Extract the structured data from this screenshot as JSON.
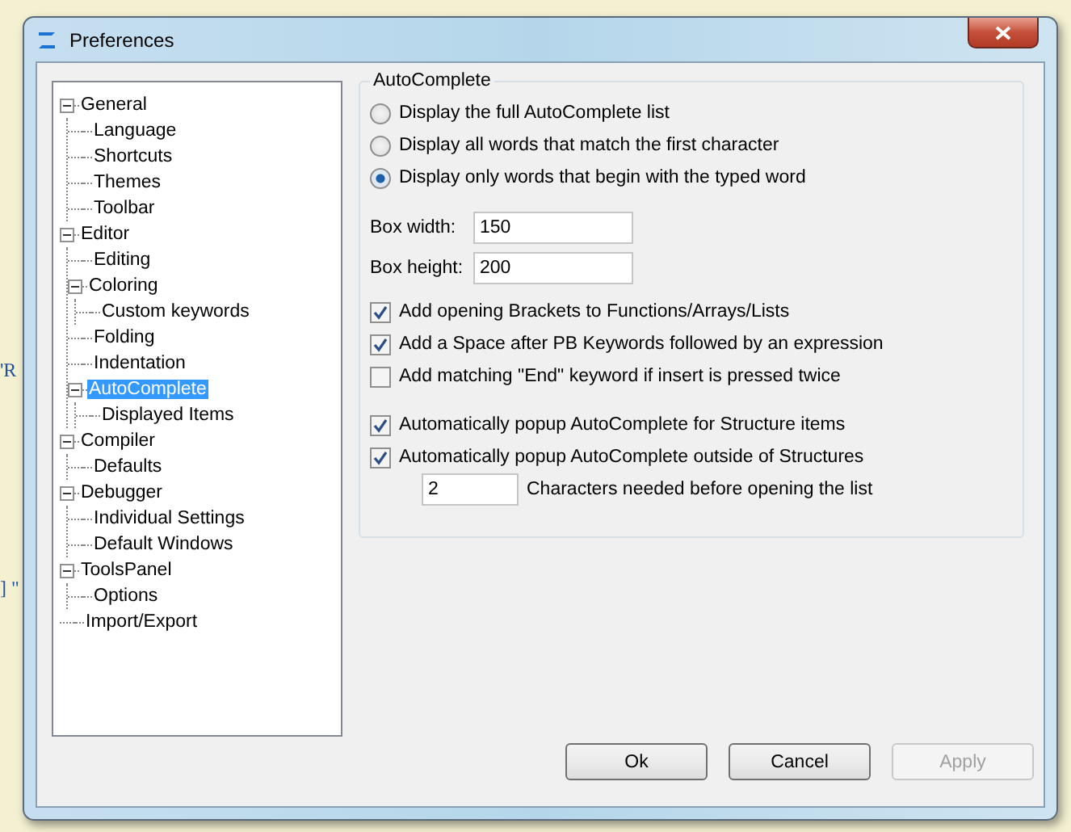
{
  "backdrop_texts": [
    "'R",
    "] \""
  ],
  "window": {
    "title": "Preferences"
  },
  "tree": [
    {
      "label": "General",
      "expanded": true,
      "selected": false,
      "children": [
        {
          "label": "Language",
          "selected": false
        },
        {
          "label": "Shortcuts",
          "selected": false
        },
        {
          "label": "Themes",
          "selected": false
        },
        {
          "label": "Toolbar",
          "selected": false
        }
      ]
    },
    {
      "label": "Editor",
      "expanded": true,
      "selected": false,
      "children": [
        {
          "label": "Editing",
          "selected": false
        },
        {
          "label": "Coloring",
          "expanded": true,
          "selected": false,
          "children": [
            {
              "label": "Custom keywords",
              "selected": false
            }
          ]
        },
        {
          "label": "Folding",
          "selected": false
        },
        {
          "label": "Indentation",
          "selected": false
        },
        {
          "label": "AutoComplete",
          "expanded": true,
          "selected": true,
          "children": [
            {
              "label": "Displayed Items",
              "selected": false
            }
          ]
        }
      ]
    },
    {
      "label": "Compiler",
      "expanded": true,
      "selected": false,
      "children": [
        {
          "label": "Defaults",
          "selected": false
        }
      ]
    },
    {
      "label": "Debugger",
      "expanded": true,
      "selected": false,
      "children": [
        {
          "label": "Individual Settings",
          "selected": false
        },
        {
          "label": "Default Windows",
          "selected": false
        }
      ]
    },
    {
      "label": "ToolsPanel",
      "expanded": true,
      "selected": false,
      "children": [
        {
          "label": "Options",
          "selected": false
        }
      ]
    },
    {
      "label": "Import/Export",
      "selected": false
    }
  ],
  "group": {
    "title": "AutoComplete",
    "radios": [
      {
        "label": "Display the full AutoComplete list",
        "selected": false
      },
      {
        "label": "Display all words that match the first character",
        "selected": false
      },
      {
        "label": "Display only words that begin with the typed word",
        "selected": true
      }
    ],
    "fields": [
      {
        "label": "Box width:",
        "value": "150"
      },
      {
        "label": "Box height:",
        "value": "200"
      }
    ],
    "checkbox_groups": [
      [
        {
          "label": "Add opening Brackets to Functions/Arrays/Lists",
          "checked": true
        },
        {
          "label": "Add a Space after PB Keywords followed by an expression",
          "checked": true
        },
        {
          "label": "Add matching \"End\" keyword if insert is pressed twice",
          "checked": false
        }
      ],
      [
        {
          "label": "Automatically popup AutoComplete for Structure items",
          "checked": true
        },
        {
          "label": "Automatically popup AutoComplete outside of Structures",
          "checked": true
        }
      ]
    ],
    "chars": {
      "value": "2",
      "label": "Characters needed before opening the list"
    }
  },
  "buttons": [
    {
      "label": "Ok",
      "disabled": false
    },
    {
      "label": "Cancel",
      "disabled": false
    },
    {
      "label": "Apply",
      "disabled": true
    }
  ]
}
